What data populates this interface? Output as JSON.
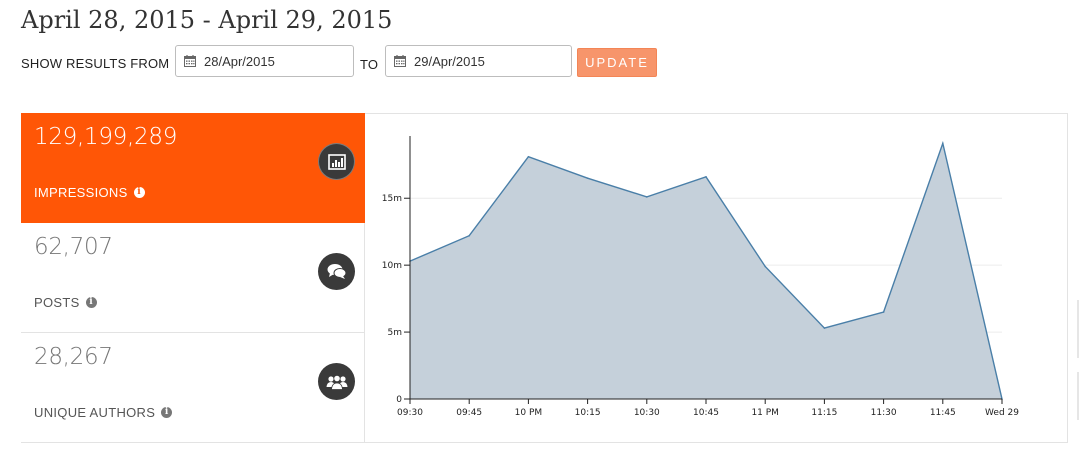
{
  "header": {
    "title": "April 28, 2015 - April 29, 2015"
  },
  "filters": {
    "show_from_label": "SHOW RESULTS FROM",
    "from_value": "28/Apr/2015",
    "to_label": "TO",
    "to_value": "29/Apr/2015",
    "update_label": "UPDATE"
  },
  "stats": [
    {
      "value": "129,199,289",
      "label": "IMPRESSIONS",
      "icon": "bar-chart-icon",
      "active": true
    },
    {
      "value": "62,707",
      "label": "POSTS",
      "icon": "chat-bubbles-icon",
      "active": false
    },
    {
      "value": "28,267",
      "label": "UNIQUE AUTHORS",
      "icon": "group-icon",
      "active": false
    }
  ],
  "colors": {
    "accent": "#ff5606",
    "update_button": "#f7956b",
    "area_fill": "#c5d0da",
    "area_stroke": "#4a7fa8"
  },
  "chart_data": {
    "type": "area",
    "categories": [
      "09:30",
      "09:45",
      "10 PM",
      "10:15",
      "10:30",
      "10:45",
      "11 PM",
      "11:15",
      "11:30",
      "11:45",
      "Wed 29"
    ],
    "values": [
      10300000,
      12200000,
      18100000,
      16500000,
      15100000,
      16600000,
      9900000,
      5300000,
      6500000,
      19100000,
      0
    ],
    "ylim": [
      0,
      19500000
    ],
    "y_ticks": [
      0,
      5000000,
      10000000,
      15000000
    ],
    "y_tick_labels": [
      "0",
      "5m",
      "10m",
      "15m"
    ],
    "grid": "horizontal"
  }
}
